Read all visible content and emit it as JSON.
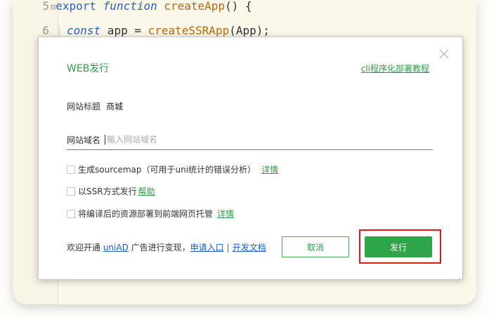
{
  "editor": {
    "line5": {
      "num": "5",
      "kw": "export",
      "kw2": "function",
      "fn": "createApp",
      "rest": "() {"
    },
    "line6": {
      "num": "6",
      "kw": "const",
      "plain1": " app = ",
      "fn": "createSSRApp",
      "rest": "(App);"
    }
  },
  "dialog": {
    "title": "WEB发行",
    "cli_link": "cli程序化部署教程",
    "site_title_label": "网站标题",
    "site_title_value": "商城",
    "domain_label": "网站域名",
    "domain_placeholder": "输入网站域名",
    "options": [
      {
        "label": "生成sourcemap（可用于uni统计的错误分析）",
        "link": "详情",
        "checked": false
      },
      {
        "label": "以SSR方式发行",
        "link": "帮助",
        "checked": false
      },
      {
        "label": "将编译后的资源部署到前端网页托管",
        "link": "详情",
        "checked": false
      }
    ],
    "footer": {
      "prefix": "欢迎开通 ",
      "uniad": "uniAD",
      "middle": " 广告进行变现，",
      "apply": "申请入口",
      "sep": "|",
      "docs": "开发文档"
    },
    "cancel_label": "取消",
    "publish_label": "发行"
  },
  "colors": {
    "accent": "#2e9b4a",
    "link": "#1a5fd0",
    "highlight": "#e0181c"
  }
}
